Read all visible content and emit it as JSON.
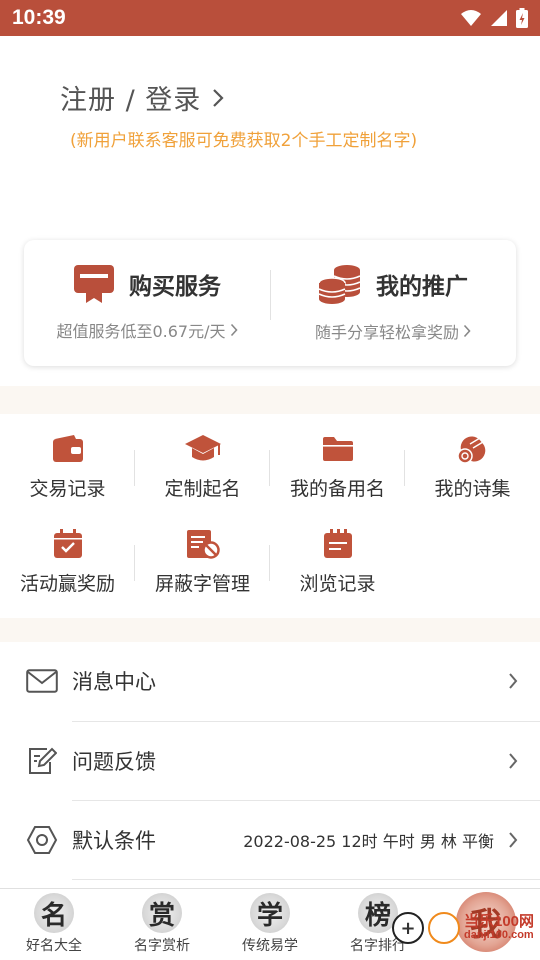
{
  "status_bar": {
    "time": "10:39"
  },
  "account": {
    "login_label": "注册 / 登录",
    "promo_text": "(新用户联系客服可免费获取2个手工定制名字)"
  },
  "service_card": {
    "buy": {
      "title": "购买服务",
      "subtitle": "超值服务低至0.67元/天"
    },
    "promo": {
      "title": "我的推广",
      "subtitle": "随手分享轻松拿奖励"
    }
  },
  "grid": {
    "items": [
      {
        "label": "交易记录",
        "icon": "wallet-icon"
      },
      {
        "label": "定制起名",
        "icon": "graduation-cap-icon"
      },
      {
        "label": "我的备用名",
        "icon": "folder-icon"
      },
      {
        "label": "我的诗集",
        "icon": "scroll-icon"
      },
      {
        "label": "活动赢奖励",
        "icon": "calendar-check-icon"
      },
      {
        "label": "屏蔽字管理",
        "icon": "blocked-document-icon"
      },
      {
        "label": "浏览记录",
        "icon": "notepad-icon"
      }
    ]
  },
  "menu": {
    "items": [
      {
        "label": "消息中心",
        "icon": "mail-icon"
      },
      {
        "label": "问题反馈",
        "icon": "edit-note-icon"
      },
      {
        "label": "默认条件",
        "icon": "hexagon-icon",
        "value": "2022-08-25 12时 午时 男 林 平衡"
      }
    ]
  },
  "tabs": [
    {
      "label": "好名大全",
      "seal": "名"
    },
    {
      "label": "名字赏析",
      "seal": "赏"
    },
    {
      "label": "传统易学",
      "seal": "学"
    },
    {
      "label": "名字排行",
      "seal": "榜"
    },
    {
      "label": "",
      "seal": "我",
      "active": true
    }
  ],
  "watermark": {
    "text": "当乐100网",
    "subtext": "danji100.com"
  },
  "colors": {
    "brand": "#b94f3b",
    "promo": "#f0a13a",
    "card_icon": "#b94f3b",
    "grid_icon": "#c0533b"
  }
}
